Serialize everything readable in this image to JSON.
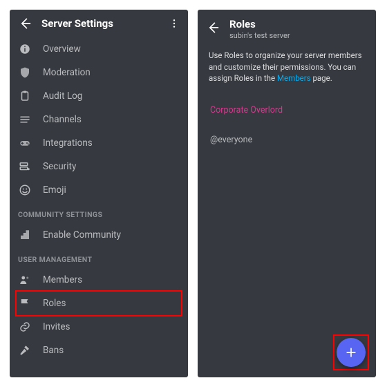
{
  "left": {
    "title": "Server Settings",
    "menu": {
      "overview": "Overview",
      "moderation": "Moderation",
      "audit_log": "Audit Log",
      "channels": "Channels",
      "integrations": "Integrations",
      "security": "Security",
      "emoji": "Emoji"
    },
    "section_community": "COMMUNITY SETTINGS",
    "community": {
      "enable": "Enable Community"
    },
    "section_user_mgmt": "USER MANAGEMENT",
    "user_mgmt": {
      "members": "Members",
      "roles": "Roles",
      "invites": "Invites",
      "bans": "Bans"
    }
  },
  "right": {
    "title": "Roles",
    "subtitle": "subin's test server",
    "description_pre": "Use Roles to organize your server members and customize their permissions. You can assign Roles in the ",
    "description_link": "Members",
    "description_post": " page.",
    "roles": {
      "corporate": "Corporate Overlord",
      "everyone": "@everyone"
    }
  }
}
